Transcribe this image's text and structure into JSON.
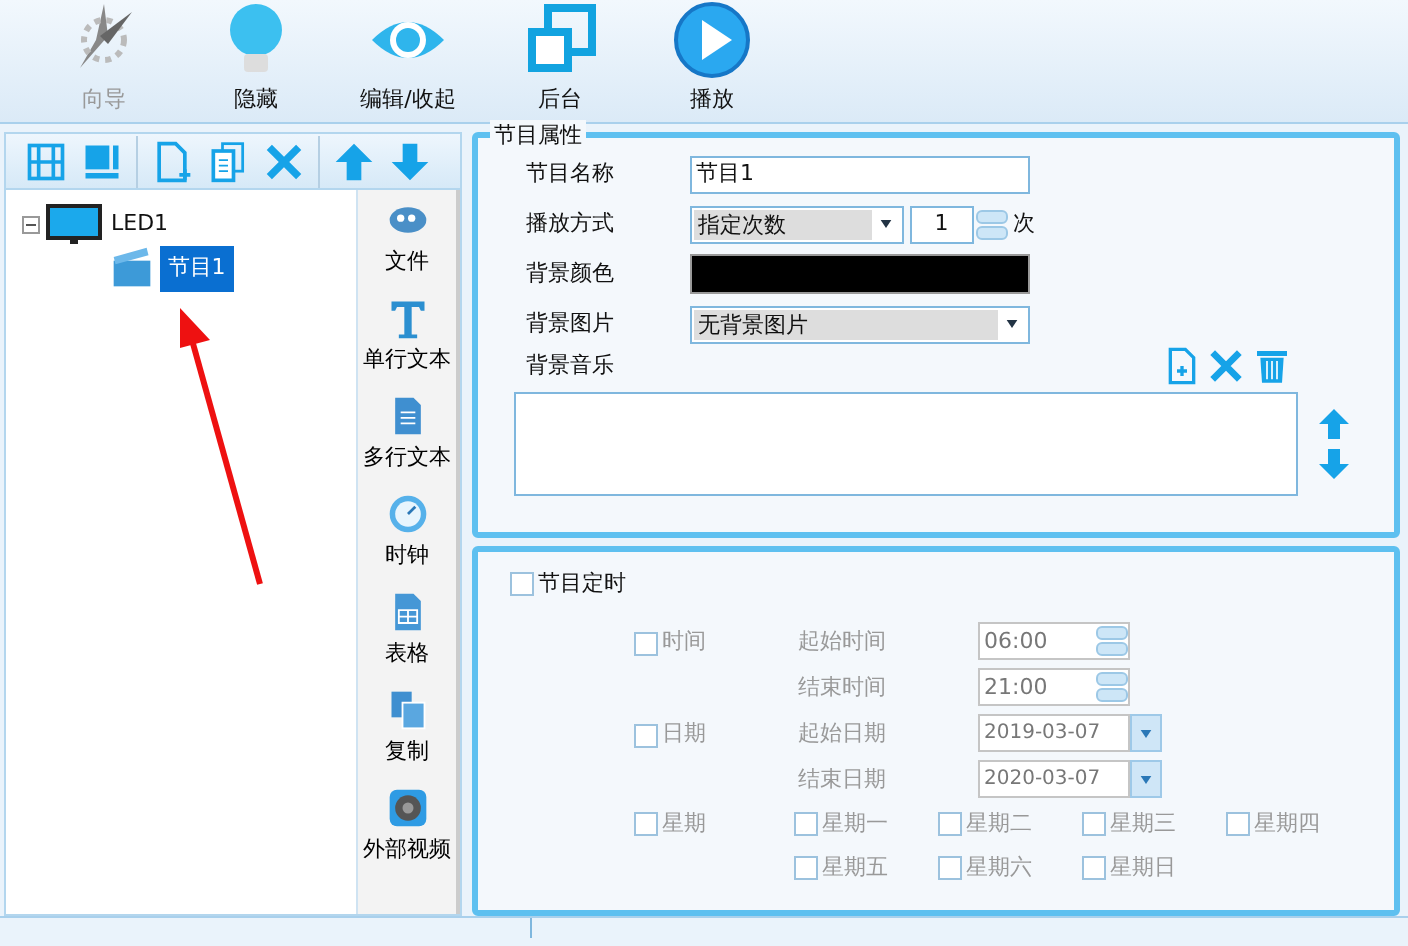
{
  "toolbar": [
    {
      "label": "向导",
      "disabled": true
    },
    {
      "label": "隐藏",
      "disabled": false
    },
    {
      "label": "编辑/收起",
      "disabled": false
    },
    {
      "label": "后台",
      "disabled": false
    },
    {
      "label": "播放",
      "disabled": false
    }
  ],
  "tree": [
    {
      "label": "LED1",
      "expanded": true,
      "selected": false,
      "children": [
        {
          "label": "节目1",
          "selected": true
        }
      ]
    }
  ],
  "insert_tools": [
    "文件",
    "单行文本",
    "多行文本",
    "时钟",
    "表格",
    "复制",
    "外部视频"
  ],
  "properties": {
    "title": "节目属性",
    "name_label": "节目名称",
    "name_value": "节目1",
    "mode_label": "播放方式",
    "mode_value": "指定次数",
    "count_value": "1",
    "count_unit": "次",
    "color_label": "背景颜色",
    "image_label": "背景图片",
    "image_value": "无背景图片",
    "music_label": "背景音乐"
  },
  "timing": {
    "label": "节目定时",
    "checked": false,
    "groups": [
      {
        "label": "时间",
        "checked": false,
        "disabled": true,
        "rows": [
          {
            "label": "起始时间",
            "value": "06:00",
            "kind": "spin"
          },
          {
            "label": "结束时间",
            "value": "21:00",
            "kind": "spin"
          }
        ]
      },
      {
        "label": "日期",
        "checked": false,
        "disabled": true,
        "rows": [
          {
            "label": "起始日期",
            "value": "2019-03-07",
            "kind": "date"
          },
          {
            "label": "结束日期",
            "value": "2020-03-07",
            "kind": "date"
          }
        ]
      }
    ],
    "weekday": {
      "label": "星期",
      "checked": false,
      "disabled": true,
      "days": [
        {
          "label": "星期一",
          "checked": false
        },
        {
          "label": "星期二",
          "checked": false
        },
        {
          "label": "星期三",
          "checked": false
        },
        {
          "label": "星期四",
          "checked": false
        },
        {
          "label": "星期五",
          "checked": false
        },
        {
          "label": "星期六",
          "checked": false
        },
        {
          "label": "星期日",
          "checked": false
        }
      ]
    }
  }
}
